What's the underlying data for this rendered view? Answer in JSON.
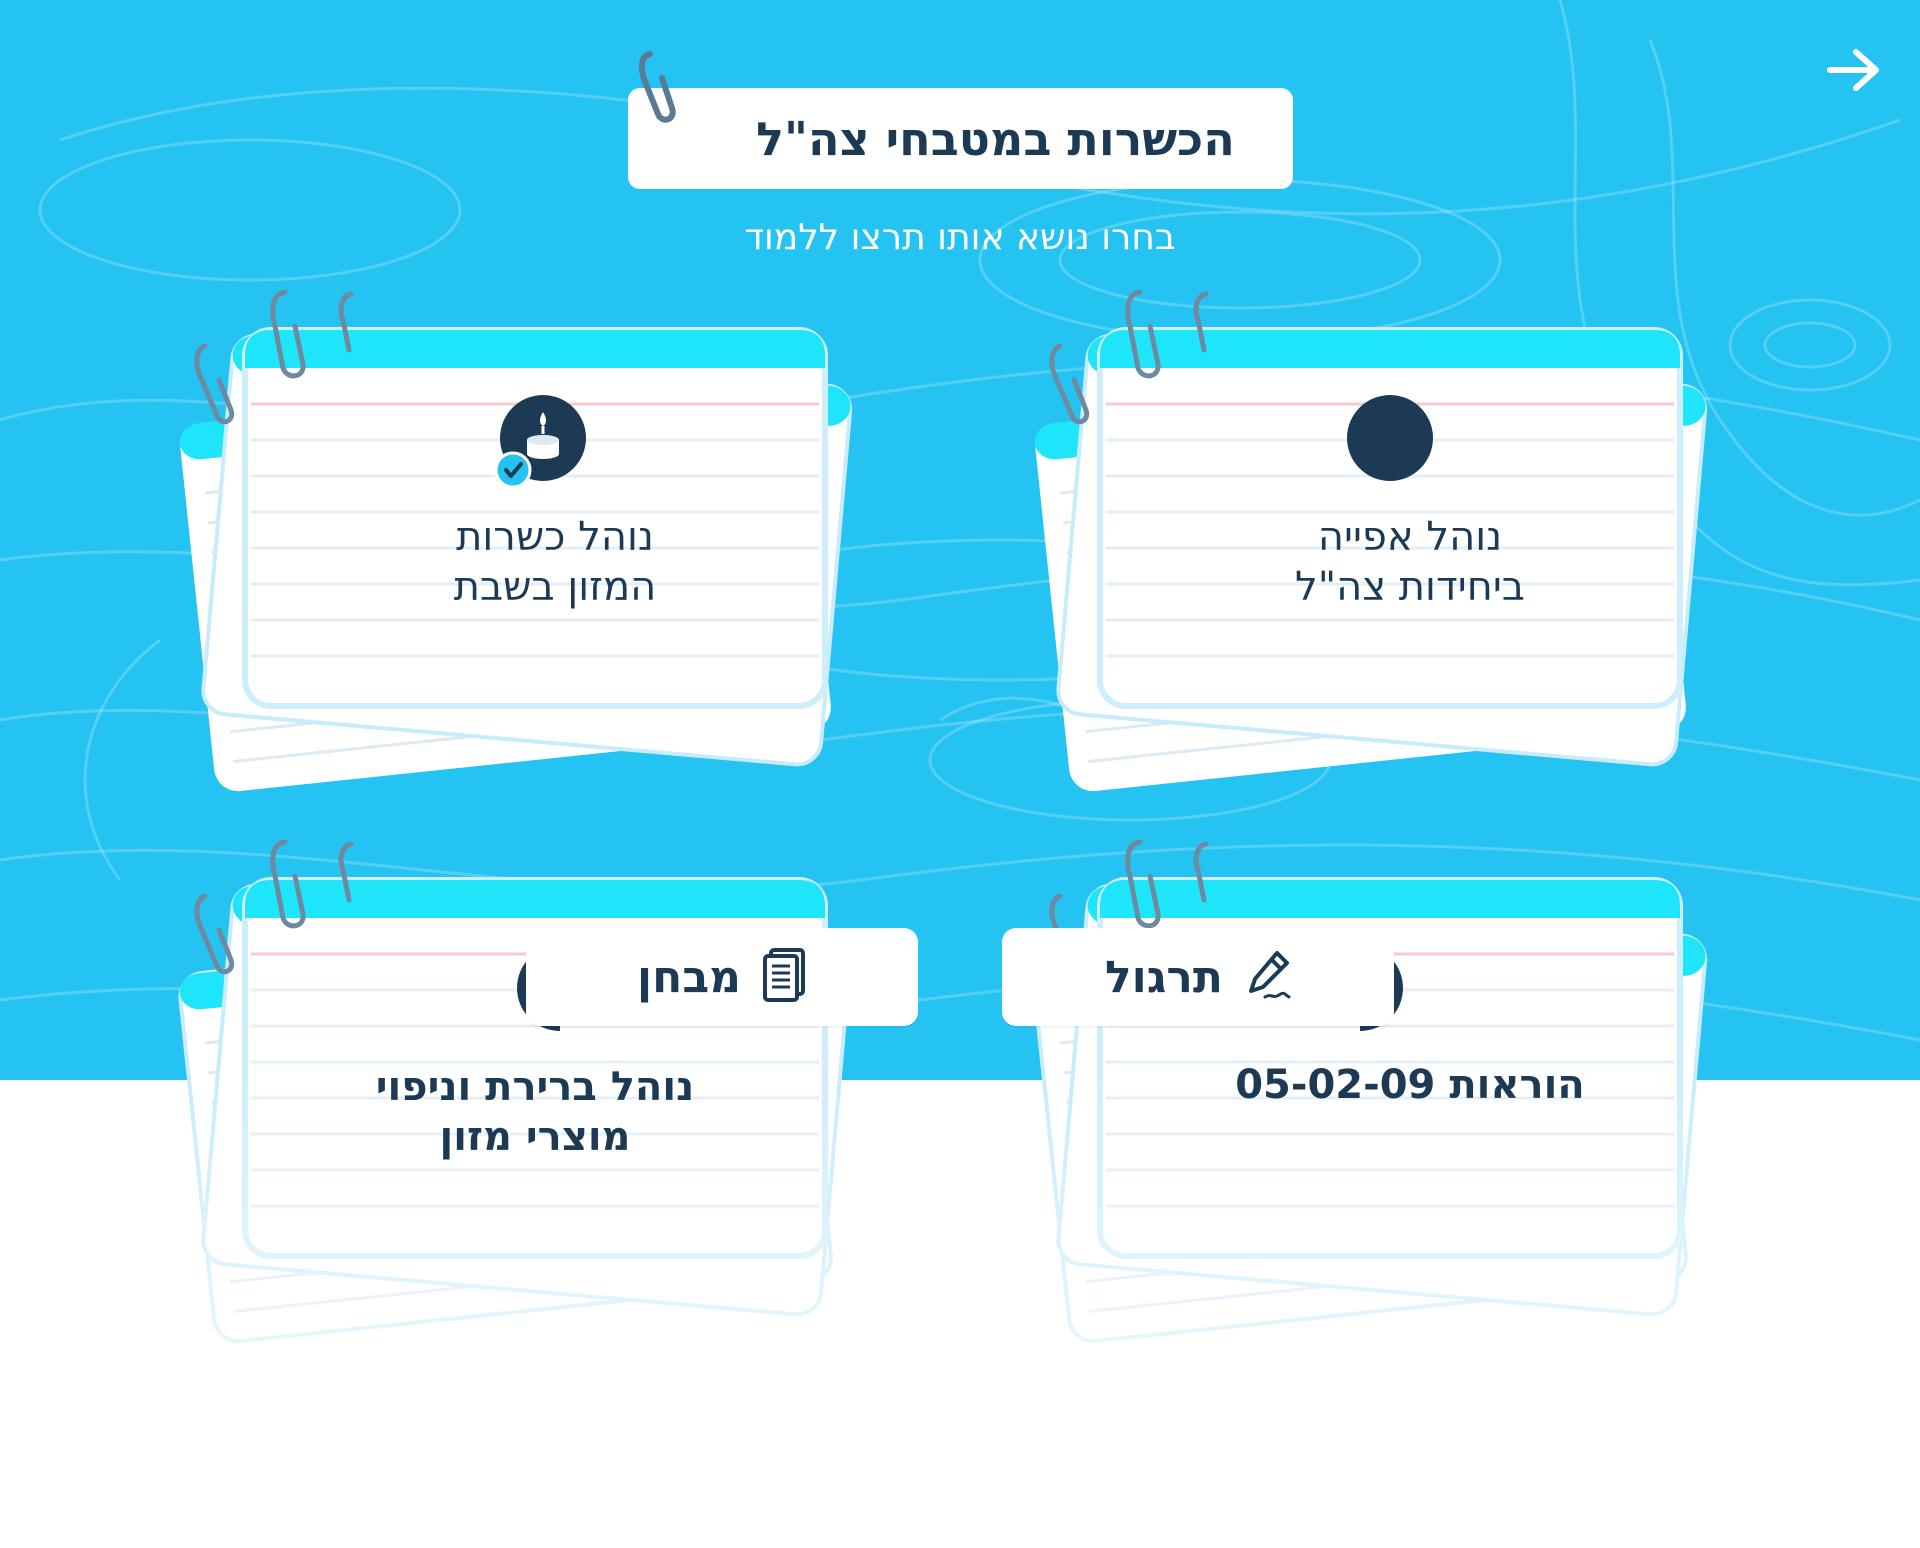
{
  "header": {
    "title": "הכשרות במטבחי צה\"ל",
    "subtitle": "בחרו נושא אותו תרצו ללמוד"
  },
  "navigation": {
    "next_icon": "arrow-right-icon"
  },
  "topics": [
    {
      "label_line1": "נוהל אפייה",
      "label_line2": "ביחידות צה\"ל",
      "icon": "circle-icon"
    },
    {
      "label_line1": "נוהל כשרות",
      "label_line2": "המזון בשבת",
      "icon": "shabbat-candle-icon"
    },
    {
      "label_line1": "הוראות 05-02-09",
      "label_line2": "",
      "icon": ""
    },
    {
      "label_line1": "נוהל ברירת וניפוי",
      "label_line2": "מוצרי מזון",
      "icon": ""
    }
  ],
  "actions": {
    "practice_label": "תרגול",
    "practice_icon": "pencil-icon",
    "quiz_label": "מבחן",
    "quiz_icon": "document-icon"
  },
  "colors": {
    "background": "#25c3f2",
    "card_header": "#1fe5fa",
    "navy": "#1d3a55",
    "white": "#ffffff"
  }
}
